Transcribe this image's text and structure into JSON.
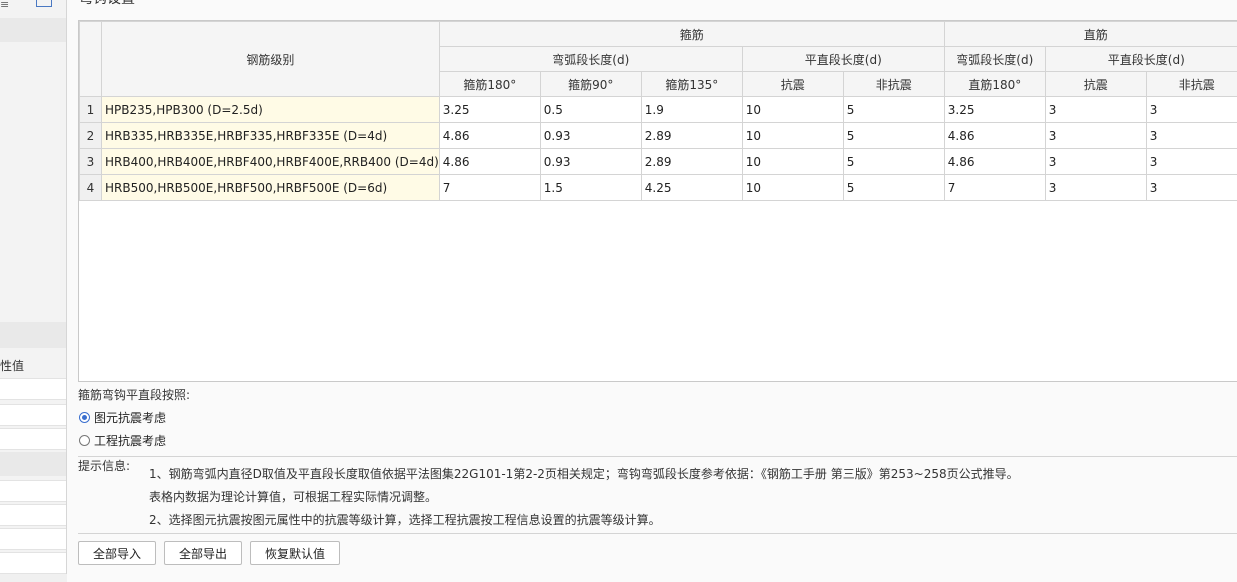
{
  "background": {
    "property_value_label": "性值"
  },
  "dialog": {
    "title": "弯钩设置",
    "grid": {
      "headers": {
        "grade": "钢筋级别",
        "stirrup_group": "箍筋",
        "straight_group": "直筋",
        "arc_len": "弯弧段长度(d)",
        "flat_len": "平直段长度(d)",
        "s180": "箍筋180°",
        "s90": "箍筋90°",
        "s135": "箍筋135°",
        "seismic": "抗震",
        "non_seismic": "非抗震",
        "z180": "直筋180°"
      },
      "rows": [
        {
          "n": "1",
          "grade": "HPB235,HPB300 (D=2.5d)",
          "s180": "3.25",
          "s90": "0.5",
          "s135": "1.9",
          "seis": "10",
          "nseis": "5",
          "z180": "3.25",
          "zseis": "3",
          "znseis": "3"
        },
        {
          "n": "2",
          "grade": "HRB335,HRB335E,HRBF335,HRBF335E (D=4d)",
          "s180": "4.86",
          "s90": "0.93",
          "s135": "2.89",
          "seis": "10",
          "nseis": "5",
          "z180": "4.86",
          "zseis": "3",
          "znseis": "3"
        },
        {
          "n": "3",
          "grade": "HRB400,HRB400E,HRBF400,HRBF400E,RRB400 (D=4d)",
          "s180": "4.86",
          "s90": "0.93",
          "s135": "2.89",
          "seis": "10",
          "nseis": "5",
          "z180": "4.86",
          "zseis": "3",
          "znseis": "3"
        },
        {
          "n": "4",
          "grade": "HRB500,HRB500E,HRBF500,HRBF500E (D=6d)",
          "s180": "7",
          "s90": "1.5",
          "s135": "4.25",
          "seis": "10",
          "nseis": "5",
          "z180": "7",
          "zseis": "3",
          "znseis": "3"
        }
      ]
    },
    "radio_group": {
      "title": "箍筋弯钩平直段按照:",
      "options": [
        {
          "label": "图元抗震考虑",
          "checked": true
        },
        {
          "label": "工程抗震考虑",
          "checked": false
        }
      ]
    },
    "tips": {
      "label": "提示信息:",
      "line1": "1、钢筋弯弧内直径D取值及平直段长度取值依据平法图集22G101-1第2-2页相关规定；弯钩弯弧段长度参考依据：《钢筋工手册 第三版》第253~258页公式推导。",
      "line2": "表格内数据为理论计算值，可根据工程实际情况调整。",
      "line3": "2、选择图元抗震按图元属性中的抗震等级计算，选择工程抗震按工程信息设置的抗震等级计算。"
    },
    "buttons": {
      "import_all": "全部导入",
      "export_all": "全部导出",
      "restore_default": "恢复默认值"
    }
  }
}
